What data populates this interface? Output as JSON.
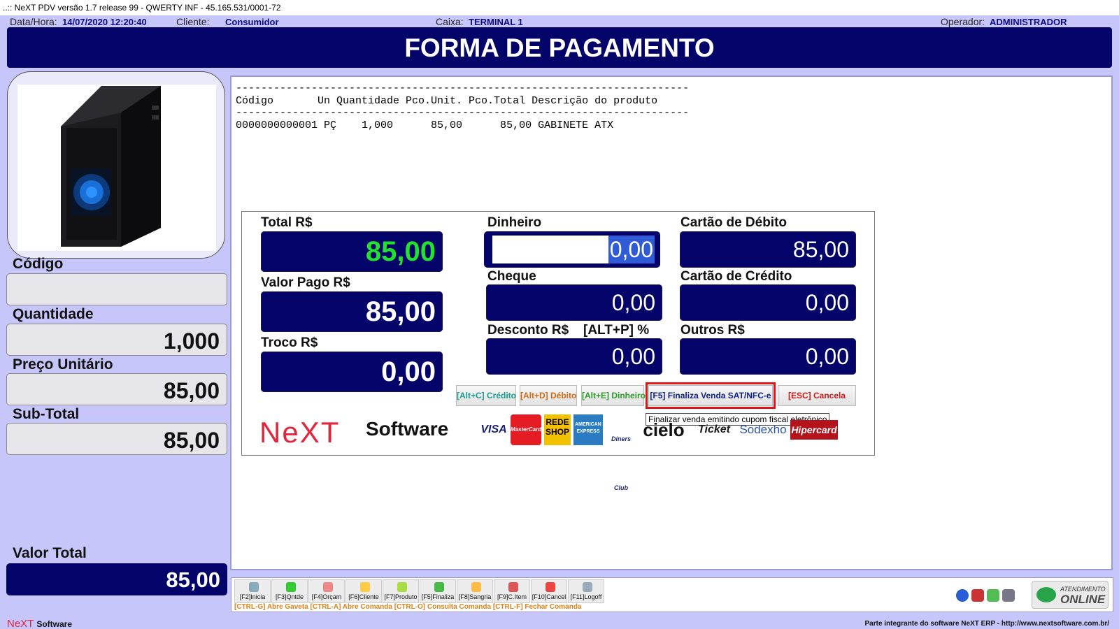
{
  "window": {
    "title": "..:: NeXT PDV versão 1.7 release 99 - QWERTY INF - 45.165.531/0001-72"
  },
  "info": {
    "datahora_label": "Data/Hora:",
    "datahora_value": "14/07/2020 12:20:40",
    "cliente_label": "Cliente:",
    "cliente_value": "Consumidor",
    "caixa_label": "Caixa:",
    "caixa_value": "TERMINAL 1",
    "operador_label": "Operador:",
    "operador_value": "ADMINISTRADOR"
  },
  "header": {
    "title": "FORMA DE PAGAMENTO"
  },
  "left": {
    "codigo_label": "Código",
    "codigo_value": "",
    "quantidade_label": "Quantidade",
    "quantidade_value": "1,000",
    "preco_label": "Preço Unitário",
    "preco_value": "85,00",
    "subtotal_label": "Sub-Total",
    "subtotal_value": "85,00",
    "valortotal_label": "Valor Total",
    "valortotal_value": "85,00"
  },
  "receipt": {
    "separator": "------------------------------------------------------------------------",
    "header_line": "Código       Un Quantidade Pco.Unit. Pco.Total Descrição do produto",
    "item_line": "0000000000001 PÇ    1,000      85,00      85,00 GABINETE ATX"
  },
  "payment": {
    "total_label": "Total R$",
    "total_value": "85,00",
    "valor_pago_label": "Valor Pago R$",
    "valor_pago_value": "85,00",
    "troco_label": "Troco R$",
    "troco_value": "0,00",
    "dinheiro_label": "Dinheiro",
    "dinheiro_value": "0,00",
    "cheque_label": "Cheque",
    "cheque_value": "0,00",
    "desconto_label": "Desconto R$",
    "desconto_shortcut": "[ALT+P] %",
    "desconto_value": "0,00",
    "debito_label": "Cartão de Débito",
    "debito_value": "85,00",
    "credito_label": "Cartão de Crédito",
    "credito_value": "0,00",
    "outros_label": "Outros R$",
    "outros_value": "0,00"
  },
  "buttons": {
    "credito": "[Alt+C] Crédito",
    "debito": "[Alt+D] Débito",
    "dinheiro": "[Alt+E] Dinheiro",
    "finaliza": "[F5] Finaliza Venda SAT/NFC-e",
    "cancela": "[ESC] Cancela"
  },
  "tooltip": "Finalizar venda emitindo cupom fiscal eletrônico",
  "logo": {
    "next": "NeXT",
    "software": "Software"
  },
  "card_brands": [
    "VISA",
    "MasterCard",
    "REDE SHOP",
    "AMERICAN EXPRESS",
    "Diners Club",
    "cielo",
    "Ticket",
    "Sodexho",
    "Hipercard"
  ],
  "toolbar": {
    "items": [
      {
        "label": "[F2]Inicia",
        "icon": "home-icon"
      },
      {
        "label": "[F3]Qntde",
        "icon": "plus-icon"
      },
      {
        "label": "[F4]Orçam",
        "icon": "budget-icon"
      },
      {
        "label": "[F6]Cliente",
        "icon": "client-icon"
      },
      {
        "label": "[F7]Produto",
        "icon": "product-icon"
      },
      {
        "label": "[F5]Finaliza",
        "icon": "dollar-icon"
      },
      {
        "label": "[F8]Sangria",
        "icon": "cash-icon"
      },
      {
        "label": "[F9]C.Item",
        "icon": "cancel-item-icon"
      },
      {
        "label": "[F10]Cancel",
        "icon": "cancel-icon"
      },
      {
        "label": "[F11]Logoff",
        "icon": "logoff-icon"
      }
    ],
    "shortcuts": "[CTRL-G] Abre Gaveta  [CTRL-A] Abre Comanda  [CTRL-O] Consulta Comanda  [CTRL-F] Fechar Comanda",
    "online_top": "ATENDIMENTO",
    "online_main": "ONLINE"
  },
  "footer": {
    "left_logo": "NeXT",
    "left_text": "Software",
    "right_text": "Parte integrante do software NeXT ERP - http://www.nextsoftware.com.br/"
  },
  "colors": {
    "background": "#c6c6fa",
    "navy": "#030369",
    "total_green": "#21e22d",
    "focus_red": "#e01616",
    "brand_red": "#e2263c"
  }
}
